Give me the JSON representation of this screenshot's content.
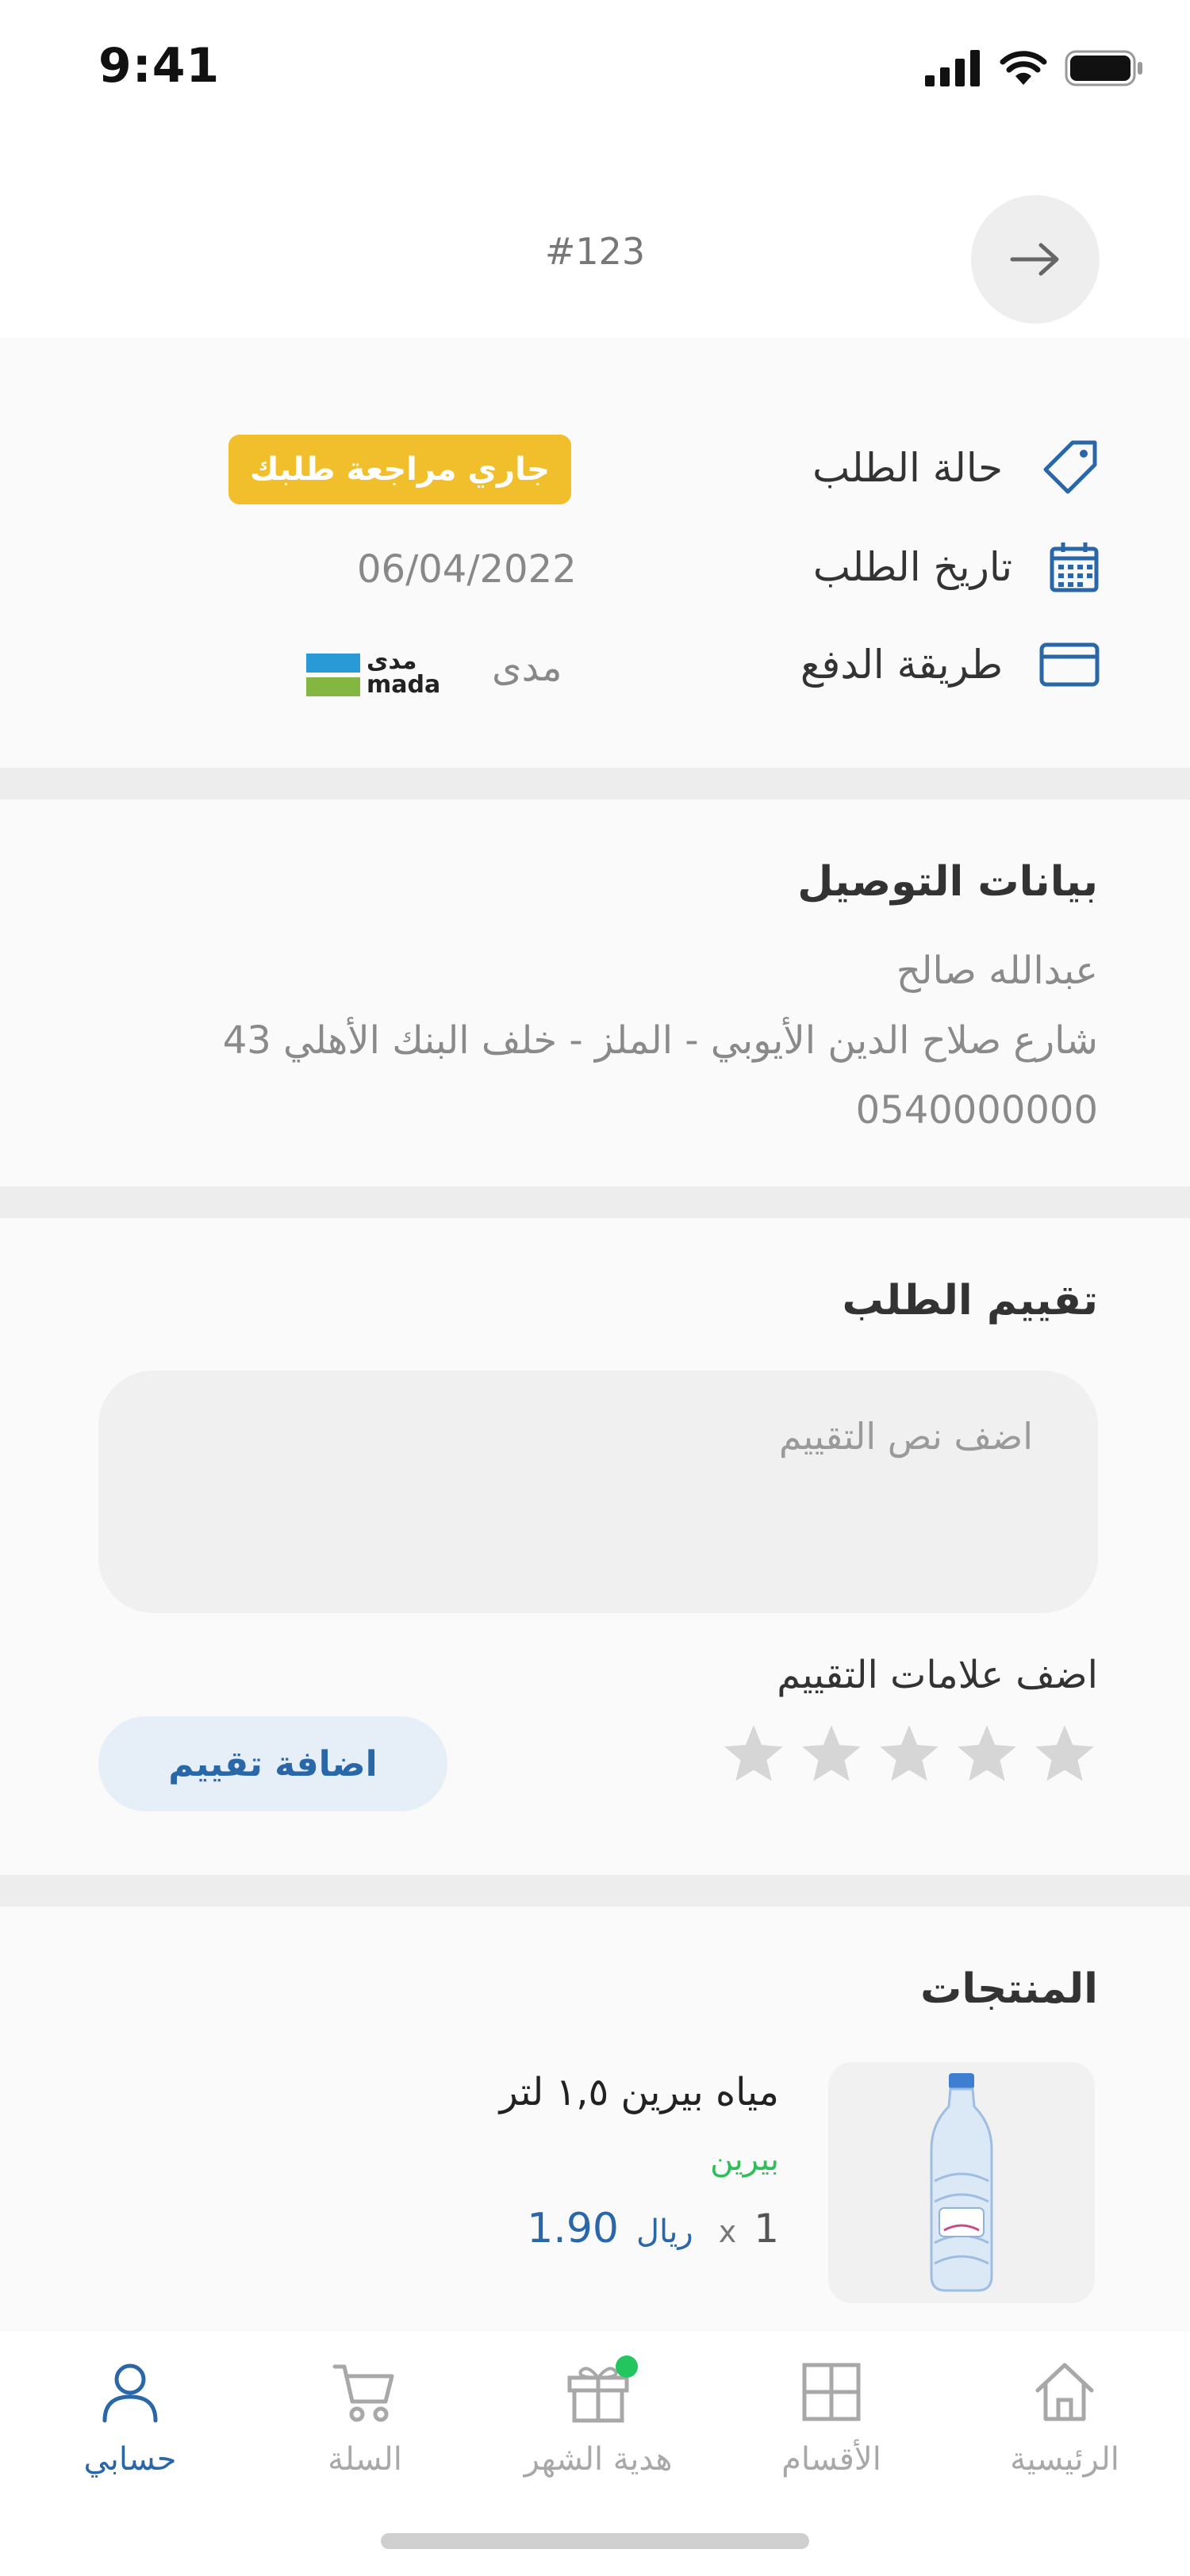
{
  "status_bar": {
    "time": "9:41"
  },
  "header": {
    "order_number": "#123"
  },
  "order_info": {
    "status_label": "حالة الطلب",
    "status_badge": "جاري مراجعة طلبك",
    "date_label": "تاريخ الطلب",
    "date_value": "06/04/2022",
    "payment_label": "طريقة الدفع",
    "payment_value": "مدى",
    "payment_logo_ar": "مدى",
    "payment_logo_en": "mada"
  },
  "delivery": {
    "title": "بيانات التوصيل",
    "name": "عبدالله صالح",
    "address": "شارع صلاح الدين الأيوبي - الملز - خلف البنك الأهلي 43",
    "phone": "0540000000"
  },
  "review": {
    "title": "تقييم الطلب",
    "placeholder": "اضف نص التقييم",
    "stars_label": "اضف علامات التقييم",
    "rating": 0,
    "max_rating": 5,
    "submit_label": "اضافة تقييم"
  },
  "products": {
    "title": "المنتجات",
    "items": [
      {
        "name": "مياه بيرين ١,٥ لتر",
        "brand": "بيرين",
        "quantity": "1",
        "quantity_sign": "x",
        "price": "1.90",
        "currency": "ريال"
      }
    ]
  },
  "bottom_nav": {
    "items": [
      {
        "label": "الرئيسية",
        "icon": "home-icon"
      },
      {
        "label": "الأقسام",
        "icon": "grid-icon"
      },
      {
        "label": "هدية الشهر",
        "icon": "gift-icon"
      },
      {
        "label": "السلة",
        "icon": "cart-icon"
      },
      {
        "label": "حسابي",
        "icon": "user-icon",
        "active": true
      }
    ]
  },
  "colors": {
    "accent": "#2a67a8",
    "badge": "#f2bf2c",
    "brand_green": "#2fbf5a",
    "notification_dot": "#22c55e"
  }
}
